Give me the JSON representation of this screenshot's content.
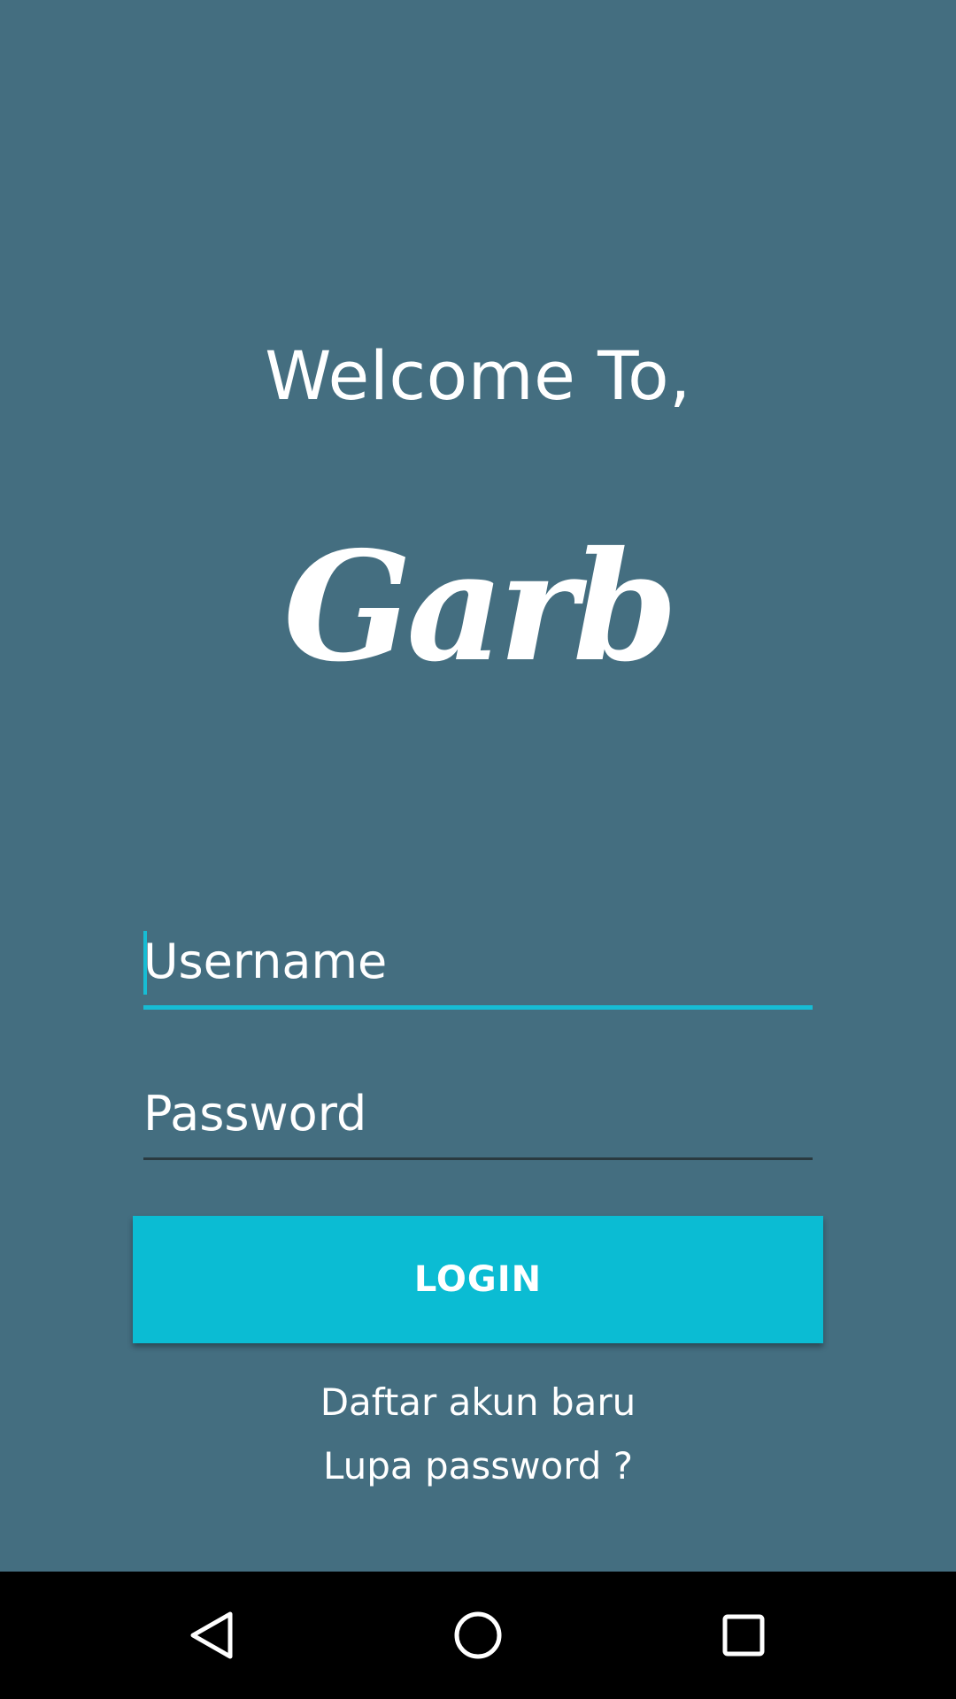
{
  "header": {
    "welcome_text": "Welcome To,"
  },
  "logo": {
    "text": "Garb",
    "color": "#ffffff"
  },
  "form": {
    "username_placeholder": "Username",
    "password_placeholder": "Password",
    "login_label": "LOGIN"
  },
  "links": {
    "register": "Daftar akun baru",
    "forgot": "Lupa password ?"
  },
  "nav": {
    "back_icon": "back-triangle-icon",
    "home_icon": "home-circle-icon",
    "recent_icon": "recent-apps-square-icon"
  },
  "colors": {
    "background": "#446e80",
    "accent": "#0bbcd3",
    "navbar": "#000000"
  }
}
